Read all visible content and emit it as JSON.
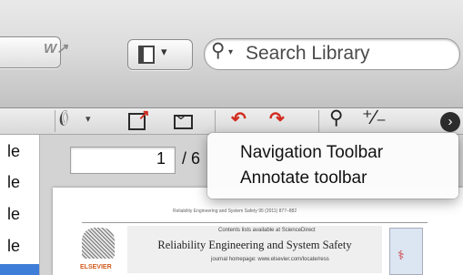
{
  "search": {
    "placeholder": "Search Library"
  },
  "toolbar": {
    "word_button_icon": "word-export-icon",
    "layout_button_icon": "layout-view-icon"
  },
  "pdf_toolbar": {
    "icons": [
      "paperclip-icon",
      "export-icon",
      "mail-icon",
      "rotate-left-icon",
      "rotate-right-icon",
      "zoom-icon",
      "zoom-toggle-icon",
      "more-icon"
    ]
  },
  "list": {
    "rows": [
      "le",
      "le",
      "le",
      "le"
    ]
  },
  "pager": {
    "current_page": "1",
    "separator": "/ 6"
  },
  "pdf": {
    "citation": "Reliability Engineering and System Safety 95 (2011) 877–882",
    "contents": "Contents lists available at ScienceDirect",
    "journal": "Reliability Engineering and System Safety",
    "homepage": "journal homepage: www.elsevier.com/locate/ress",
    "publisher": "ELSEVIER"
  },
  "menu": {
    "items": [
      "Navigation Toolbar",
      "Annotate toolbar"
    ]
  },
  "colors": {
    "accent_red": "#d22b1e",
    "selection_blue": "#3f7ed8"
  }
}
